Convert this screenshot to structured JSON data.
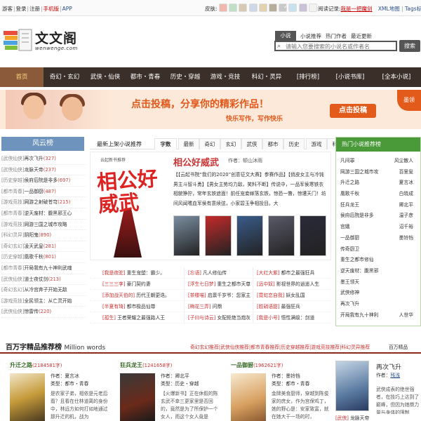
{
  "topbar": {
    "guest": "游客",
    "login": "登录",
    "register": "注册",
    "mobile": "手机版",
    "app": "APP",
    "skin_label": "皮肤:",
    "skins": [
      "#f4b7b0",
      "#bfe0c4",
      "#d7c9b3",
      "#ced8e6",
      "#e3d1b0",
      "#b5ad9a",
      "#c8c8c8",
      "#c7e1ef",
      "#c9c1d8",
      "#f2f2f2"
    ],
    "read_record_label": "阅读记录:",
    "read_record_value": "我是一把魔剑",
    "xml_map": "XML地图",
    "tags": "Tags标签"
  },
  "logo": {
    "brand": "文文阁",
    "sub": "wenwenge.com"
  },
  "search": {
    "tab_active": "小说",
    "tab1": "小说推荐",
    "tab2": "热门作者",
    "tab3": "最近更新",
    "placeholder": "请输入您要搜索的小说名或作者名",
    "button": "搜索"
  },
  "nav": {
    "items": [
      "首页",
      "奇幻・玄幻",
      "武侠・仙侠",
      "都市・青春",
      "历史・穿越",
      "游戏・竞技",
      "科幻・灵异",
      "[排行榜]",
      "[小说书库]",
      "[全本小说]"
    ]
  },
  "banner": {
    "slogan": "点击投稿，分享你的精彩作品！",
    "slogan2": "快乐写作，写作快乐",
    "button": "点击投稿",
    "corner": "墨领"
  },
  "left": {
    "title": "风云榜",
    "items": [
      {
        "genre": "[武侠仙侠]",
        "name": "再次飞升",
        "num": "(327)"
      },
      {
        "genre": "[武侠仙侠]",
        "name": "龙脉天帝",
        "num": "(237)"
      },
      {
        "genre": "[历史穿越]",
        "name": "侯府后院是非多",
        "num": "(697)"
      },
      {
        "genre": "[都市青春]",
        "name": "一品御厨",
        "num": "(487)"
      },
      {
        "genre": "[游戏竞技]",
        "name": "网游之射破苍穹",
        "num": "(215)"
      },
      {
        "genre": "[都市青春]",
        "name": "逆天废材：腹黑邪王心",
        "num": ""
      },
      {
        "genre": "[游戏竞技]",
        "name": "网游三国之城市攻略",
        "num": ""
      },
      {
        "genre": "[科幻灵异]",
        "name": "阴阳鬼",
        "num": "(890)"
      },
      {
        "genre": "[奇幻玄幻]",
        "name": "凌天武皇",
        "num": "(281)"
      },
      {
        "genre": "[历史穿越]",
        "name": "凰歌千秋",
        "num": "(801)"
      },
      {
        "genre": "[都市青春]",
        "name": "开局我有九十神利武魂",
        "num": ""
      },
      {
        "genre": "[武侠仙侠]",
        "name": "道士夜仗剑",
        "num": "(213)"
      },
      {
        "genre": "[奇幻玄幻]",
        "name": "从冷宫弃子开始无敌",
        "num": ""
      },
      {
        "genre": "[游戏竞技]",
        "name": "全民领主：从亡灵开始",
        "num": ""
      },
      {
        "genre": "[武侠仙侠]",
        "name": "惊雷传",
        "num": "(220)"
      }
    ]
  },
  "center": {
    "title": "最新上架小说推荐",
    "tabs": [
      "字数",
      "最新",
      "奇幻",
      "玄幻",
      "武侠",
      "都市",
      "历史",
      "游戏",
      "科幻"
    ],
    "featured": {
      "cover_tag": "云起新书推荐",
      "cover_text": "相公好威武",
      "title": "相公好威武",
      "author_label": "作者：",
      "author": "顿山沐雨",
      "desc": "【【云起书院“我们的2020”创意征文大赛】参赛作品】【俏皮女主与冷钝男主斗智斗勇】【男女主势均力敌，笑料不断】传说中，一品军侯寒铁衣相貌狰狞，常年玄铁遮面！前任宠妾嫁落玄铁，惊恐一瞥，惊遭天门！坊间风闻嗜血军侯有意续弦，小家碧玉争相投目。大"
    },
    "thumbs": [
      "#7a8da0",
      "#c42a2a",
      "#3a5c8a",
      "#5a5a6a",
      "#2a2a3a"
    ],
    "list": [
      [
        {
          "g": "[我是夜驼]",
          "n": "重生宠塑：霸少。"
        },
        {
          "g": "[忘语]",
          "n": "凡人修仙传"
        },
        {
          "g": "[大红大紫]",
          "n": "都市之最强狂兵"
        }
      ],
      [
        {
          "g": "[三三三李]",
          "n": "豪门契约妻"
        },
        {
          "g": "[浮生七日梦]",
          "n": "重生之都市天尊"
        },
        {
          "g": "[远中奴]",
          "n": "影视世界的逍遥人生"
        }
      ],
      [
        {
          "g": "[添加战天伯的]",
          "n": "历代王朝更迭。"
        },
        {
          "g": "[茶楼喵]",
          "n": "启禀千岁爷：您家主"
        },
        {
          "g": "[霓虹恋自我]",
          "n": "妖女乱国"
        }
      ],
      [
        {
          "g": "[半夏有琦]",
          "n": "都市极品仙尊"
        },
        {
          "g": "[梅花三弄]",
          "n": "问鼎"
        },
        {
          "g": "[胜硝语甜]",
          "n": "最强狂兵"
        }
      ],
      [
        {
          "g": "[孤生]",
          "n": "王者荣耀之最强路人王"
        },
        {
          "g": "[子曰与诗云]",
          "n": "女配拒绝当炮灰"
        },
        {
          "g": "[我是小号]",
          "n": "悟性满级：剑道"
        }
      ]
    ]
  },
  "right": {
    "title": "热门小说推荐榜",
    "items": [
      {
        "n": "凡间罪",
        "a": "风尘散人"
      },
      {
        "n": "网游三国之城市攻",
        "a": "百里叟"
      },
      {
        "n": "升迁之路",
        "a": "夏言冰"
      },
      {
        "n": "凰歌千秋",
        "a": "白晓成"
      },
      {
        "n": "狂兵龙王",
        "a": "卿北平"
      },
      {
        "n": "侯府后院是非多",
        "a": "温子彦"
      },
      {
        "n": "宫娥",
        "a": "沼千裕"
      },
      {
        "n": "一品御厨",
        "a": "墨铃铛"
      },
      {
        "n": "传奇厨卫",
        "a": ""
      },
      {
        "n": "重生之都市修仙",
        "a": ""
      },
      {
        "n": "逆天废材：腹黑邪",
        "a": ""
      },
      {
        "n": "墨王领天",
        "a": ""
      },
      {
        "n": "武侠修神",
        "a": ""
      },
      {
        "n": "再次飞升",
        "a": ""
      },
      {
        "n": "开局我有九十神利",
        "a": "人世华"
      }
    ]
  },
  "bigrank": {
    "title": "百万字精品推荐榜",
    "title_en": "Million words",
    "cats": "奇幻玄幻推荐|武侠仙侠推荐|都市青春推荐|历史穿越推荐|游戏竞技推荐|科幻灵异推荐",
    "more": "百万精品"
  },
  "cards": [
    {
      "title": "升迁之路",
      "count": "(2184581字)",
      "author": "作者：夏言冰",
      "type": "类型：都市・青春",
      "desc": "是农家子弟，相依是元老后裔？且看在仕林道离的身份中，林远方如何打如地通过那升迁的机，战为"
    },
    {
      "title": "狂兵龙王",
      "count": "(1241658字)",
      "author": "作者：卿北平",
      "type": "类型：历史・穿越",
      "desc": "【火爆新书】正在休假的陈玄武不幸三更家里是否回的，竟然是为了所保护一个女人，而这个女人竟是"
    },
    {
      "title": "一品御厨",
      "count": "(1962621字)",
      "author": "作者：墨铃铛",
      "type": "类型：都市・青春",
      "desc": "金牌美食厨师，穿越到陈俊家的庶女，作为宫保鸡丁，她的野心是：安家致富，就在她大干一场的时，"
    }
  ],
  "lastcard": {
    "title": "再次飞升",
    "author_label": "作者：",
    "author": "残浅",
    "desc": "武侠成表的绝世强者，在技巧上达到了巅峰，但因为她鼎力量与身体的限制",
    "foot_g": "[武侠]",
    "foot_n": "龙脉天帝"
  }
}
